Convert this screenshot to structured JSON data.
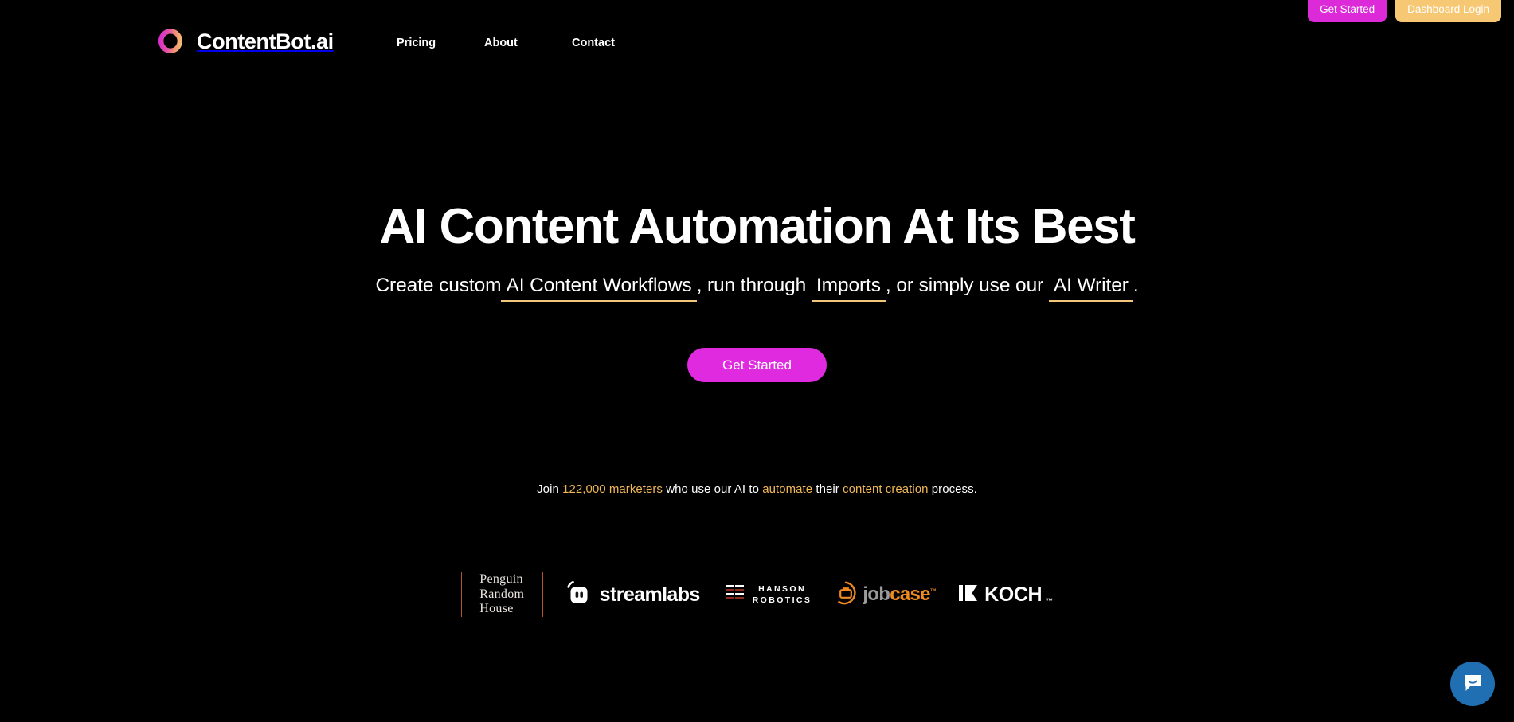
{
  "theme": {
    "background": "#000000",
    "text": "#ffffff",
    "accent_magenta": "#e02ae0",
    "accent_gold": "#f3c77b",
    "accent_orange": "#f08a21",
    "intercom_blue": "#1f6fb2"
  },
  "header": {
    "brand": {
      "logo_icon": "contentbot-ring-logo",
      "name": "ContentBot.ai"
    },
    "nav": [
      {
        "label": "Pricing",
        "name": "nav-link-pricing"
      },
      {
        "label": "About",
        "name": "nav-link-about"
      },
      {
        "label": "Contact",
        "name": "nav-link-contact"
      }
    ],
    "actions": {
      "get_started": "Get Started",
      "dashboard_login": "Dashboard Login"
    }
  },
  "hero": {
    "title": "AI Content Automation At Its Best",
    "subtitle": {
      "lead": "Create custom",
      "link1": "AI Content Workflows",
      "mid1": ", run through",
      "link2": "Imports",
      "mid2": ", or simply use our",
      "link3": "AI Writer",
      "tail": "."
    },
    "cta": "Get Started"
  },
  "social_proof": {
    "part1": "Join ",
    "count": "122,000 marketers",
    "part2": " who use our AI to ",
    "highlight1": "automate",
    "part3": " their ",
    "highlight2": "content creation",
    "part4": " process."
  },
  "logo_strip": {
    "logos": [
      {
        "name": "penguin-random-house-logo",
        "line1": "Penguin",
        "line2": "Random",
        "line3": "House"
      },
      {
        "name": "streamlabs-logo",
        "wordmark": "streamlabs"
      },
      {
        "name": "hanson-robotics-logo",
        "line1": "HANSON",
        "line2": "ROBOTICS"
      },
      {
        "name": "jobcase-logo",
        "part1": "job",
        "part2": "case",
        "tm": "™"
      },
      {
        "name": "koch-logo",
        "wordmark": "KOCH",
        "tm": "™"
      }
    ]
  },
  "intercom": {
    "icon": "chat-bubble-smile-icon",
    "aria": "Open Intercom Messenger"
  }
}
